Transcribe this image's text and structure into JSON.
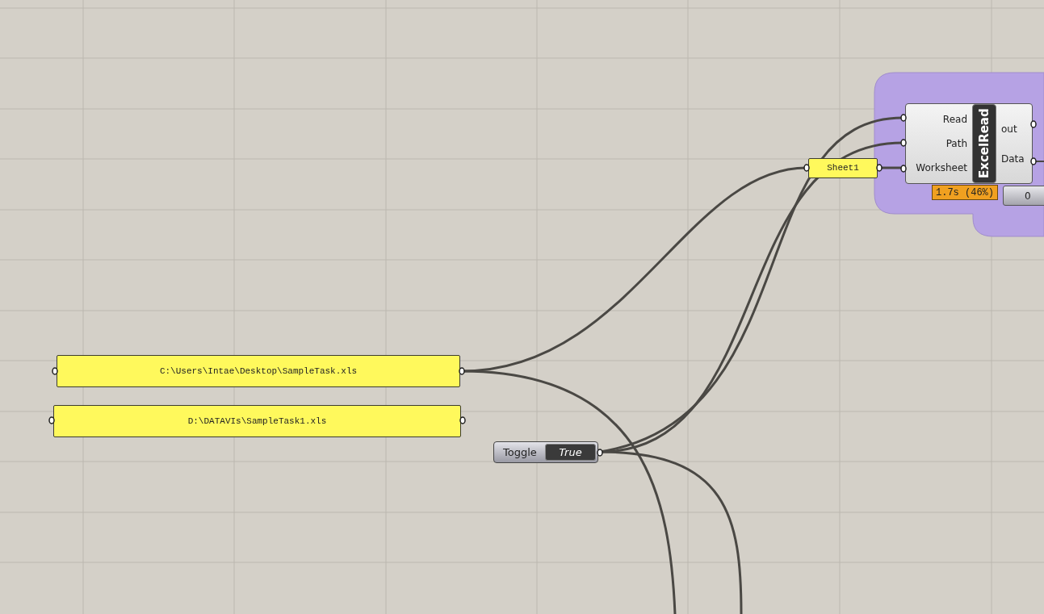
{
  "panels": [
    {
      "text": "C:\\Users\\Intae\\Desktop\\SampleTask.xls"
    },
    {
      "text": "D:\\DATAVIs\\SampleTask1.xls"
    },
    {
      "text": "Sheet1"
    }
  ],
  "toggle": {
    "label": "Toggle",
    "value": "True"
  },
  "component": {
    "name": "ExcelRead",
    "inputs": [
      "Read",
      "Path",
      "Worksheet"
    ],
    "outputs": [
      "out",
      "Data"
    ],
    "profiler": "1.7s (46%)"
  },
  "number_slider": {
    "value": "0"
  }
}
